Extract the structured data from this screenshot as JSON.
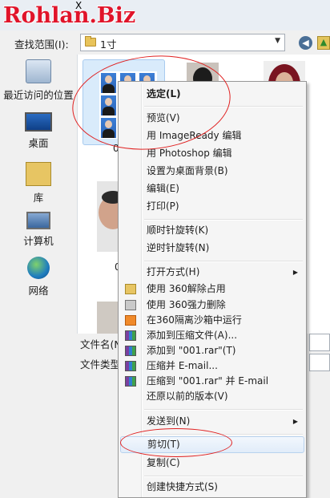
{
  "watermark": "Rohlan.Biz",
  "title_fragment": "X",
  "look_in": {
    "label": "查找范围(I):",
    "folder_name": "1寸"
  },
  "places": [
    {
      "label": "最近访问的位置",
      "icon": "recent-places-icon"
    },
    {
      "label": "桌面",
      "icon": "desktop-icon"
    },
    {
      "label": "库",
      "icon": "library-icon"
    },
    {
      "label": "计算机",
      "icon": "computer-icon"
    },
    {
      "label": "网络",
      "icon": "network-icon"
    }
  ],
  "file_captions": [
    "0",
    "0"
  ],
  "fields": {
    "file_name_label": "文件名(N",
    "file_type_label": "文件类型"
  },
  "context_menu": {
    "items": [
      {
        "label": "选定(L)",
        "bold": true
      },
      {
        "label": "预览(V)"
      },
      {
        "label": "用 ImageReady 编辑"
      },
      {
        "label": "用 Photoshop 编辑"
      },
      {
        "label": "设置为桌面背景(B)"
      },
      {
        "label": "编辑(E)"
      },
      {
        "label": "打印(P)"
      },
      {
        "label": "顺时针旋转(K)"
      },
      {
        "label": "逆时针旋转(N)"
      },
      {
        "label": "打开方式(H)",
        "submenu": true
      },
      {
        "label": "使用 360解除占用",
        "icon": "360-unlock-icon"
      },
      {
        "label": "使用 360强力删除",
        "icon": "shredder-icon"
      },
      {
        "label": "在360隔离沙箱中运行",
        "icon": "360-sandbox-icon"
      },
      {
        "label": "添加到压缩文件(A)...",
        "icon": "winrar-icon"
      },
      {
        "label": "添加到 \"001.rar\"(T)",
        "icon": "winrar-icon"
      },
      {
        "label": "压缩并 E-mail...",
        "icon": "winrar-icon"
      },
      {
        "label": "压缩到 \"001.rar\" 并 E-mail",
        "icon": "winrar-icon"
      },
      {
        "label": "还原以前的版本(V)"
      },
      {
        "label": "发送到(N)",
        "submenu": true
      },
      {
        "label": "剪切(T)",
        "highlighted": true
      },
      {
        "label": "复制(C)"
      },
      {
        "label": "创建快捷方式(S)"
      }
    ]
  },
  "colors": {
    "annotation": "#e02020",
    "watermark": "#e0142a",
    "selection": "#d9ebfb"
  }
}
